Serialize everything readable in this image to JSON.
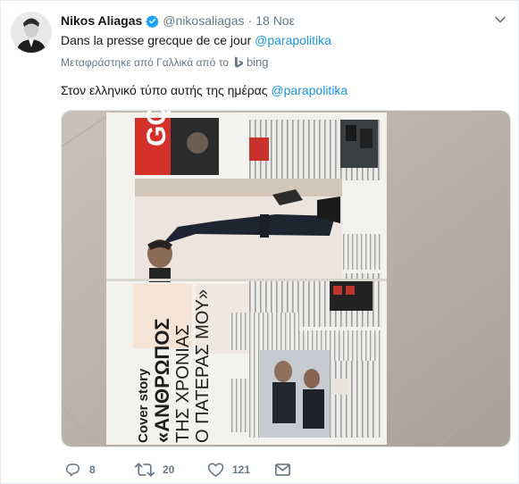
{
  "tweet": {
    "display_name": "Nikos Aliagas",
    "handle": "@nikosaliagas",
    "separator": "·",
    "timestamp": "18 Noε",
    "text_prefix": "Dans la presse grecque de ce jour",
    "text_mention": "@parapolitika",
    "translate_label": "Μεταφράστηκε από Γαλλικά από το",
    "translate_provider": "bing",
    "translated_prefix": "Στον ελληνικό τύπο αυτής της ημέρας",
    "translated_mention": "@parapolitika"
  },
  "photo": {
    "cover_label": "Cover story",
    "headline_line1": "«ΑΝΘΡΩΠΟΣ",
    "headline_line2": "ΤΗΣ ΧΡΟΝΙΑΣ",
    "headline_line3": "Ο ΠΑΤΕΡΑΣ ΜΟΥ»"
  },
  "actions": {
    "replies": "8",
    "retweets": "20",
    "likes": "121"
  },
  "icons": {
    "avatar": "avatar-image",
    "verified": "verified-badge-icon",
    "caret": "chevron-down-icon",
    "bing": "bing-logo-icon",
    "reply": "reply-icon",
    "retweet": "retweet-icon",
    "like": "heart-icon",
    "dm": "envelope-icon"
  },
  "colors": {
    "accent": "#1b95e0",
    "muted": "#657786",
    "text": "#14171a",
    "verified": "#1da1f2"
  }
}
